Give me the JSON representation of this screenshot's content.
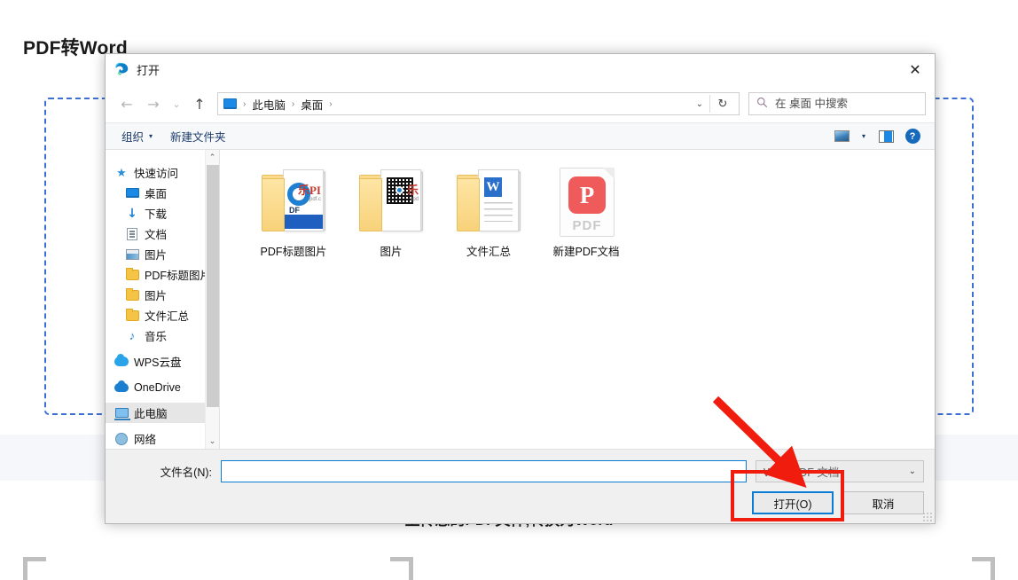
{
  "background": {
    "title": "PDF转Word",
    "subtitle": "上传您的PDF文件,转换为Word",
    "dropzone_accent": "#3b6fd4"
  },
  "dialog": {
    "title": "打开",
    "app_icon": "edge-icon",
    "close_label": "✕",
    "nav": {
      "back_icon": "←",
      "forward_icon": "→",
      "history_icon": "⌄",
      "up_icon": "↑",
      "refresh_icon": "↻",
      "dropdown_icon": "⌄"
    },
    "address": {
      "pc_icon": "this-pc-icon",
      "crumbs": [
        "此电脑",
        "桌面"
      ],
      "separator": "›"
    },
    "search": {
      "placeholder": "在 桌面 中搜索",
      "value": "",
      "icon": "search-icon"
    },
    "commandbar": {
      "organize": "组织",
      "organize_caret": "▾",
      "new_folder": "新建文件夹",
      "view_icon": "view-mode-icon",
      "view_caret": "▾",
      "preview_icon": "preview-pane-icon",
      "help_icon": "?"
    },
    "sidebar": {
      "items": [
        {
          "label": "快速访问",
          "icon": "star-icon",
          "indent": false,
          "pinned": false,
          "selected": false,
          "group": true
        },
        {
          "label": "桌面",
          "icon": "monitor-icon",
          "indent": true,
          "pinned": true,
          "selected": false,
          "group": false
        },
        {
          "label": "下载",
          "icon": "download-icon",
          "indent": true,
          "pinned": true,
          "selected": false,
          "group": false
        },
        {
          "label": "文档",
          "icon": "document-icon",
          "indent": true,
          "pinned": true,
          "selected": false,
          "group": false
        },
        {
          "label": "图片",
          "icon": "pictures-icon",
          "indent": true,
          "pinned": true,
          "selected": false,
          "group": false
        },
        {
          "label": "PDF标题图片",
          "icon": "folder-icon",
          "indent": true,
          "pinned": false,
          "selected": false,
          "group": false
        },
        {
          "label": "图片",
          "icon": "folder-icon",
          "indent": true,
          "pinned": false,
          "selected": false,
          "group": false
        },
        {
          "label": "文件汇总",
          "icon": "folder-icon",
          "indent": true,
          "pinned": false,
          "selected": false,
          "group": false
        },
        {
          "label": "音乐",
          "icon": "music-icon",
          "indent": true,
          "pinned": false,
          "selected": false,
          "group": false
        },
        {
          "label": "WPS云盘",
          "icon": "wps-cloud-icon",
          "indent": false,
          "pinned": false,
          "selected": false,
          "group": true
        },
        {
          "label": "OneDrive",
          "icon": "onedrive-icon",
          "indent": false,
          "pinned": false,
          "selected": false,
          "group": true
        },
        {
          "label": "此电脑",
          "icon": "this-pc-icon",
          "indent": false,
          "pinned": false,
          "selected": true,
          "group": true
        },
        {
          "label": "网络",
          "icon": "network-icon",
          "indent": false,
          "pinned": false,
          "selected": false,
          "group": true
        }
      ],
      "pin_glyph": "⚲",
      "scroll_up": "⌃",
      "scroll_down": "⌄"
    },
    "files": [
      {
        "name": "PDF标题图片",
        "kind": "folder",
        "art": "pdf-logo"
      },
      {
        "name": "图片",
        "kind": "folder",
        "art": "qr-code"
      },
      {
        "name": "文件汇总",
        "kind": "folder",
        "art": "word-doc"
      },
      {
        "name": "新建PDF文档",
        "kind": "file",
        "art": "pdf-file",
        "badge": "P",
        "badge_label": "PDF"
      }
    ],
    "footer": {
      "filename_label": "文件名(N):",
      "filename_value": "",
      "filetype_value": "WPS PDF 文档",
      "filetype_caret": "⌄",
      "open_label": "打开(O)",
      "cancel_label": "取消"
    }
  },
  "annotations": {
    "arrow_color": "#f01d0e",
    "rect_color": "#f01d0e"
  }
}
